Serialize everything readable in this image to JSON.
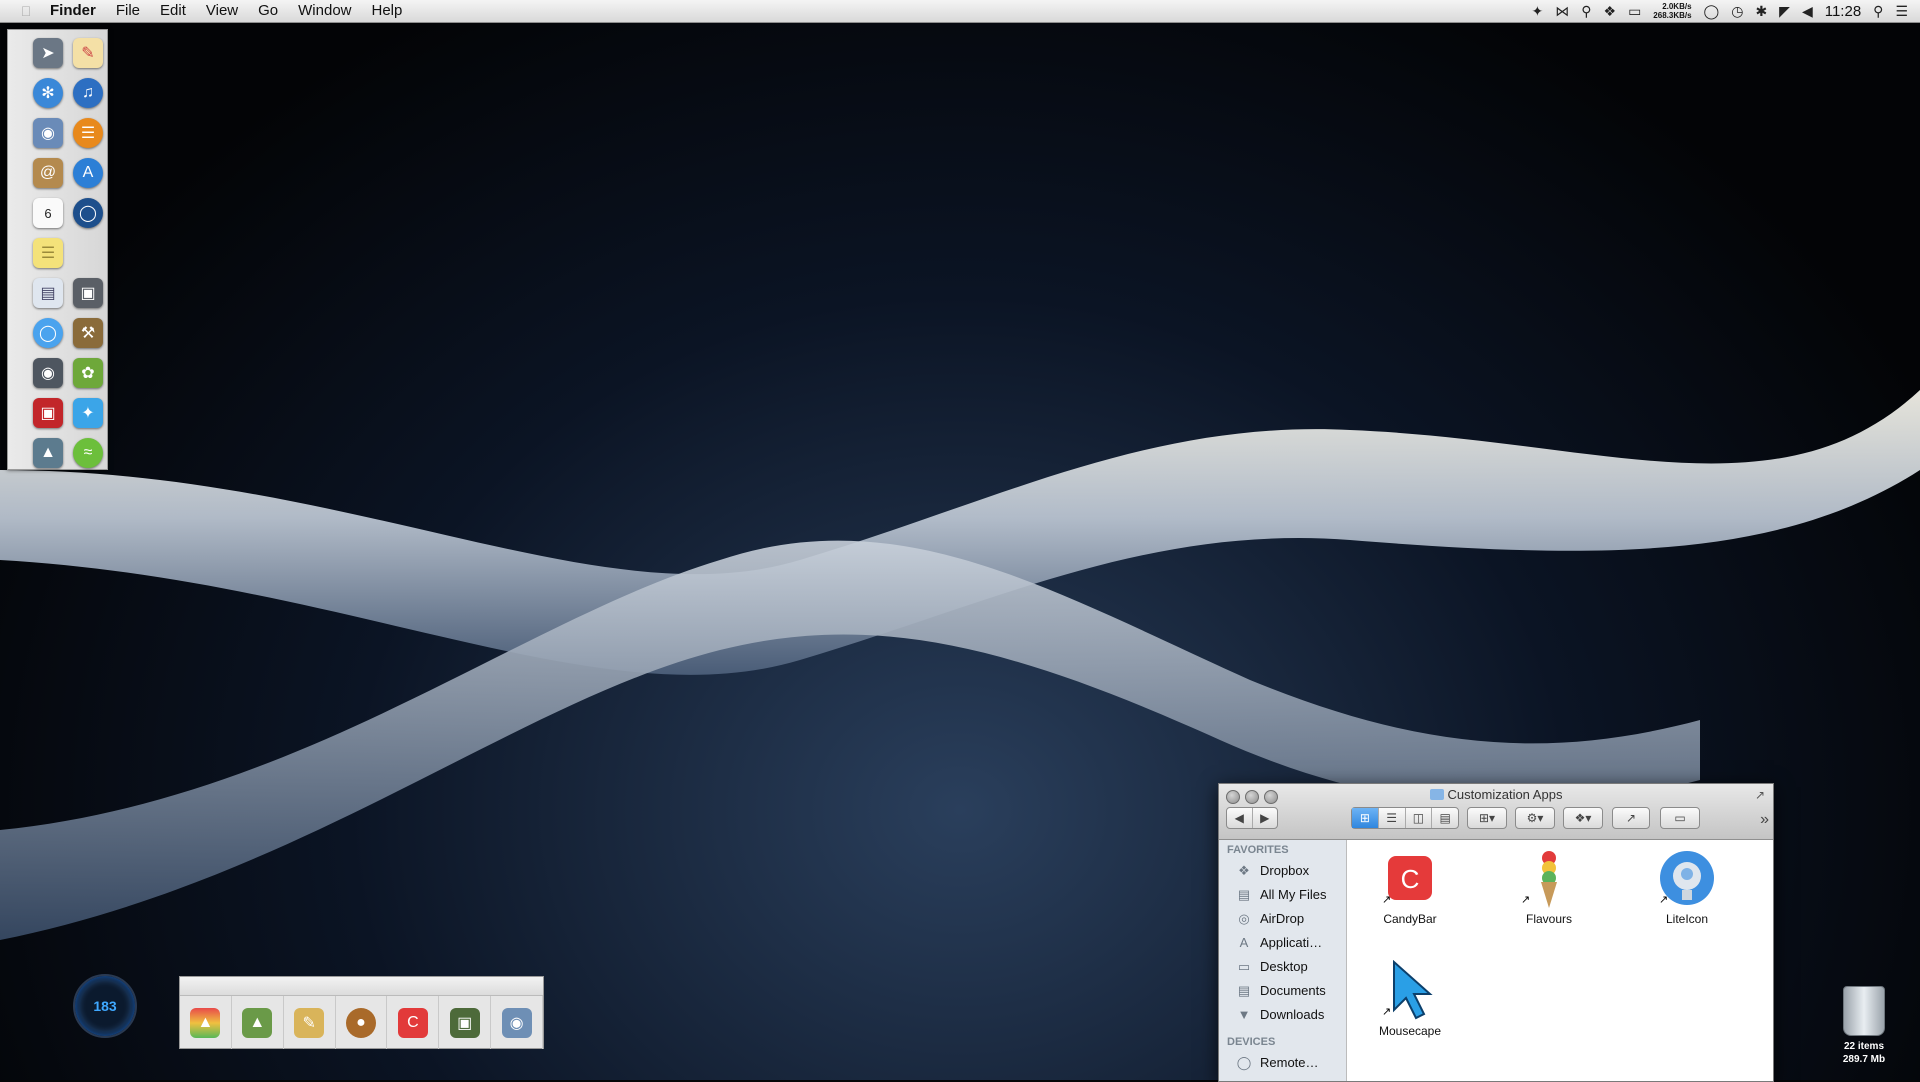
{
  "menubar": {
    "app_name": "Finder",
    "menus": [
      "File",
      "Edit",
      "View",
      "Go",
      "Window",
      "Help"
    ],
    "net_up": "2.0KB/s",
    "net_down": "268.3KB/s",
    "clock": "11:28",
    "status_icons": [
      "twitter-icon",
      "bowtie-icon",
      "key-icon",
      "dropbox-icon",
      "airplay-icon",
      "network-monitor-icon",
      "chat-icon",
      "time-machine-icon",
      "bluetooth-icon",
      "wifi-icon",
      "volume-icon",
      "spotlight-icon",
      "notification-center-icon"
    ]
  },
  "launcher": {
    "icons": [
      "launchpad-icon",
      "textedit-icon",
      "safari-icon",
      "itunes-icon",
      "preview-icon",
      "ibooks-icon",
      "contacts-icon",
      "app-store-icon",
      "calendar-icon",
      "1password-icon",
      "stickies-icon",
      "",
      "activity-monitor-icon",
      "screenshot-icon",
      "messages-icon",
      "utility-icon",
      "facetime-icon",
      "leaf-icon",
      "photo-booth-icon",
      "twitter-icon",
      "photos-icon",
      "spotify-icon"
    ],
    "calendar_day": "6"
  },
  "gauge": {
    "value": "183"
  },
  "stackbar": {
    "items": [
      "flavours-icon",
      "maps-icon",
      "draw-icon",
      "acorn-icon",
      "candybar-icon",
      "image-viewer-icon",
      "preview-app-icon"
    ]
  },
  "finder": {
    "title": "Customization Apps",
    "sidebar": {
      "favorites_header": "FAVORITES",
      "favorites": [
        {
          "label": "Dropbox",
          "icon": "dropbox-icon"
        },
        {
          "label": "All My Files",
          "icon": "all-files-icon"
        },
        {
          "label": "AirDrop",
          "icon": "airdrop-icon"
        },
        {
          "label": "Applicati…",
          "icon": "applications-icon"
        },
        {
          "label": "Desktop",
          "icon": "desktop-icon"
        },
        {
          "label": "Documents",
          "icon": "documents-icon"
        },
        {
          "label": "Downloads",
          "icon": "downloads-icon"
        }
      ],
      "devices_header": "DEVICES",
      "devices": [
        {
          "label": "Remote…",
          "icon": "disc-icon"
        }
      ]
    },
    "files": [
      {
        "label": "CandyBar",
        "icon": "candybar-icon"
      },
      {
        "label": "Flavours",
        "icon": "flavours-icon"
      },
      {
        "label": "LiteIcon",
        "icon": "liteicon-icon"
      },
      {
        "label": "Mousecape",
        "icon": "mousecape-icon"
      }
    ],
    "view_mode": "icon"
  },
  "trash": {
    "items": "22 items",
    "size": "289.7 Mb"
  },
  "colors": {
    "accent": "#2f86de",
    "sidebar_bg": "#e2e7ed",
    "menubar_bg": "#e6e6e6"
  }
}
